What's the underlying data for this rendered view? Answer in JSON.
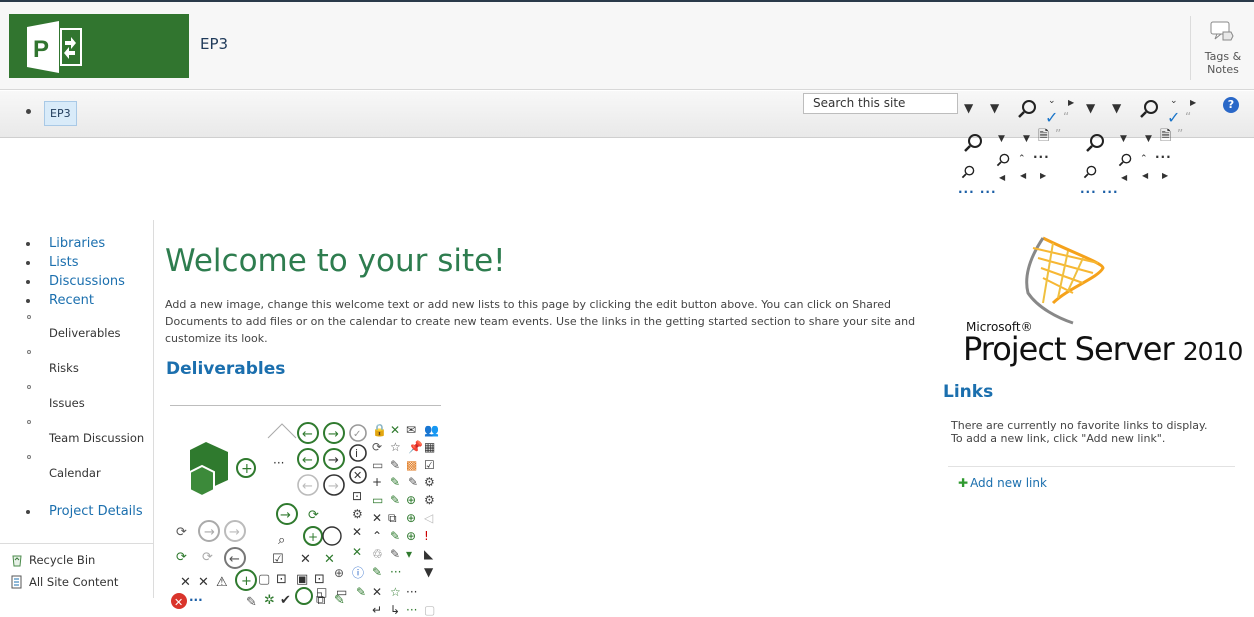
{
  "header": {
    "site_title": "EP3",
    "tags_notes_line1": "Tags &",
    "tags_notes_line2": "Notes"
  },
  "navbar": {
    "items": [
      "EP3"
    ],
    "search_placeholder": "Search this site",
    "help_label": "?"
  },
  "leftnav": {
    "items": [
      "Libraries",
      "Lists",
      "Discussions",
      "Recent"
    ],
    "recent_children": [
      "Deliverables",
      "Risks",
      "Issues",
      "Team Discussion",
      "Calendar"
    ],
    "project_details": "Project Details",
    "footer": [
      "Recycle Bin",
      "All Site Content"
    ]
  },
  "main": {
    "welcome_title": "Welcome to your site!",
    "intro_text": "Add a new image, change this welcome text or add new lists to this page by clicking the edit button above. You can click on Shared Documents to add files or on the calendar to create new team events. Use the links in the getting started section to share your site and customize its look.",
    "deliverables_title": "Deliverables"
  },
  "right": {
    "brand_microsoft": "Microsoft®",
    "brand_product": "Project Server",
    "brand_year": "2010",
    "links_title": "Links",
    "links_empty_1": "There are currently no favorite links to display.",
    "links_empty_2": "To add a new link, click \"Add new link\".",
    "add_new_link": "Add new link"
  },
  "colors": {
    "brand_green": "#31752f",
    "link_blue": "#1b6fae",
    "welcome_green": "#2e7d4f"
  },
  "icons": [
    "project-logo-icon",
    "tags-notes-icon",
    "help-icon",
    "search-icon",
    "checkmark-icon",
    "quote-icon",
    "recycle-bin-icon",
    "all-site-content-icon",
    "add-icon"
  ]
}
